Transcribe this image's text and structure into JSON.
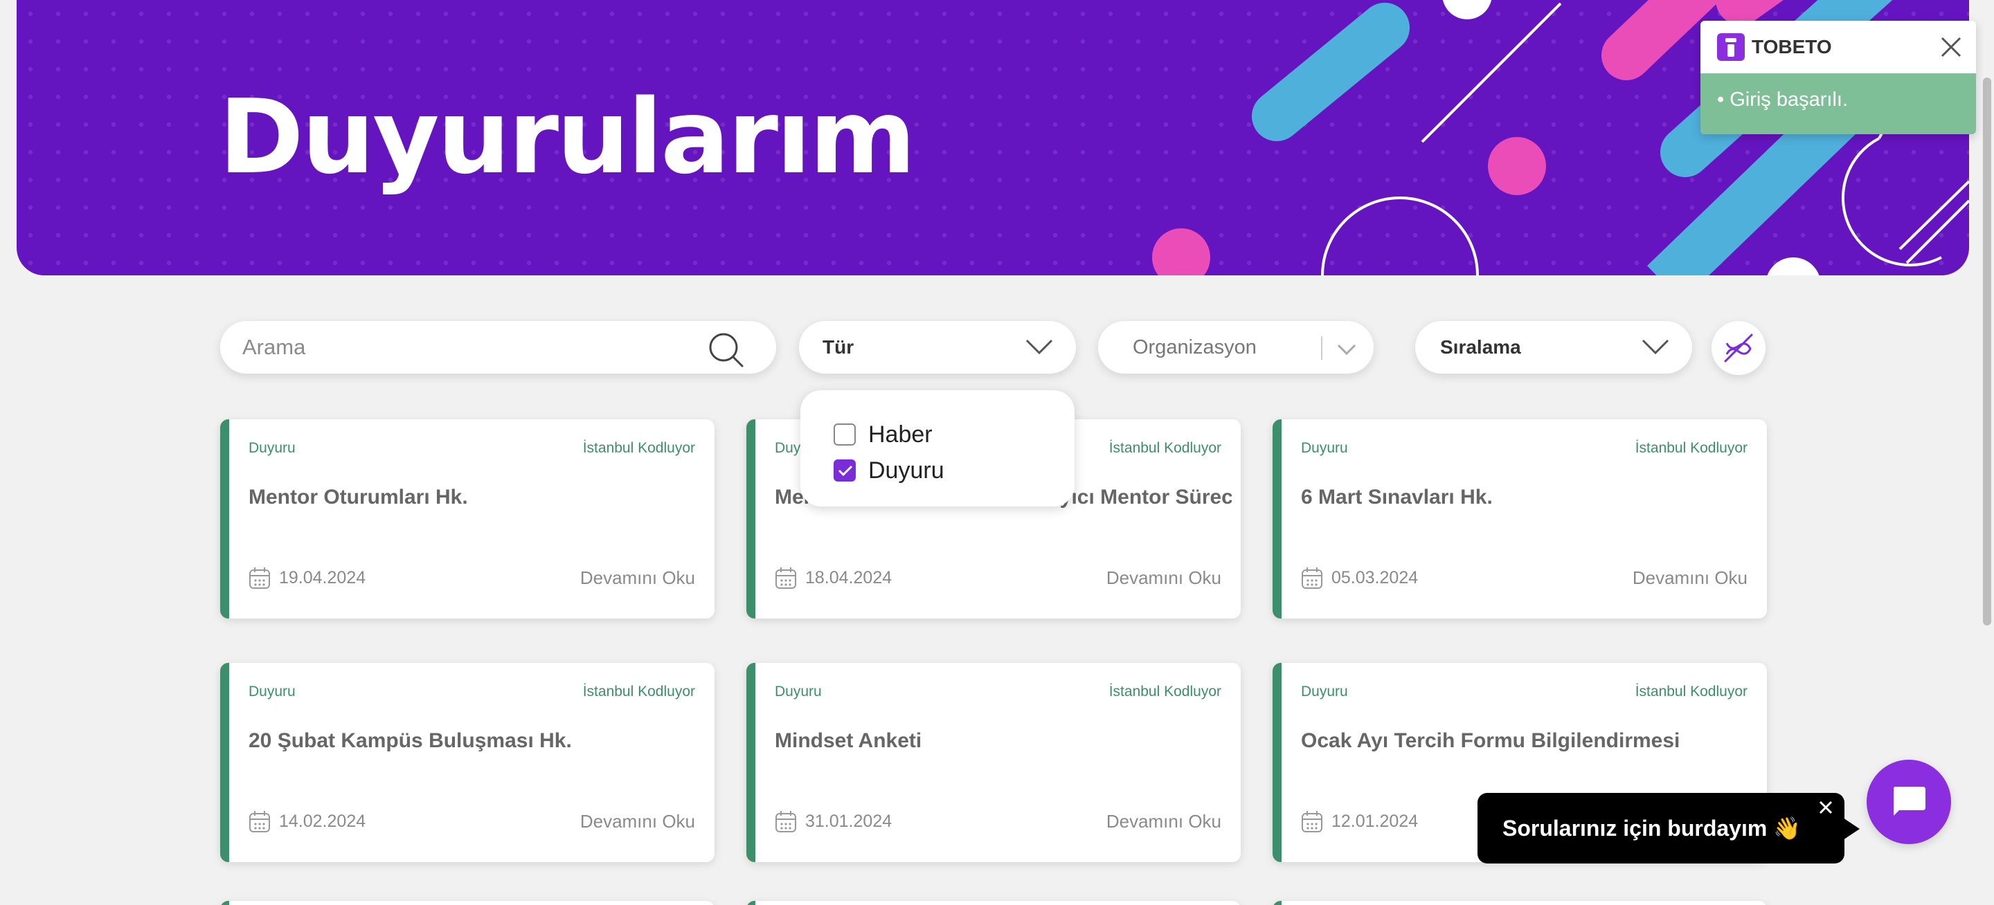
{
  "banner": {
    "title": "Duyurularım"
  },
  "filters": {
    "search_placeholder": "Arama",
    "type_label": "Tür",
    "organization_label": "Organizasyon",
    "sort_label": "Sıralama"
  },
  "type_dropdown": {
    "options": [
      {
        "label": "Haber",
        "checked": false
      },
      {
        "label": "Duyuru",
        "checked": true
      }
    ]
  },
  "cards": [
    {
      "type": "Duyuru",
      "org": "İstanbul Kodluyor",
      "title": "Mentor Oturumları Hk.",
      "date": "19.04.2024",
      "more": "Devamını Oku"
    },
    {
      "type": "Duyuru",
      "org": "İstanbul Kodluyor",
      "title": "Mentorluk ve Mülakat Hazırlayıcı Mentor Süreci",
      "date": "18.04.2024",
      "more": "Devamını Oku"
    },
    {
      "type": "Duyuru",
      "org": "İstanbul Kodluyor",
      "title": "6 Mart Sınavları Hk.",
      "date": "05.03.2024",
      "more": "Devamını Oku"
    },
    {
      "type": "Duyuru",
      "org": "İstanbul Kodluyor",
      "title": "20 Şubat Kampüs Buluşması Hk.",
      "date": "14.02.2024",
      "more": "Devamını Oku"
    },
    {
      "type": "Duyuru",
      "org": "İstanbul Kodluyor",
      "title": "Mindset Anketi",
      "date": "31.01.2024",
      "more": "Devamını Oku"
    },
    {
      "type": "Duyuru",
      "org": "İstanbul Kodluyor",
      "title": "Ocak Ayı Tercih Formu Bilgilendirmesi",
      "date": "12.01.2024",
      "more": "Devamını Oku"
    }
  ],
  "toast": {
    "title": "TOBETO",
    "message": "• Giriş başarılı."
  },
  "chat": {
    "prompt": "Sorularınız için burdayım 👋"
  },
  "colors": {
    "brand_purple": "#6515c0",
    "accent_green": "#3d8f6b",
    "toast_green": "#7fbf98",
    "chat_purple": "#8a2ee0"
  },
  "icons": [
    "search-icon",
    "chevron-down-icon",
    "filter-clear-icon",
    "calendar-icon",
    "close-icon",
    "chat-icon",
    "tobeto-logo-icon",
    "check-icon"
  ]
}
